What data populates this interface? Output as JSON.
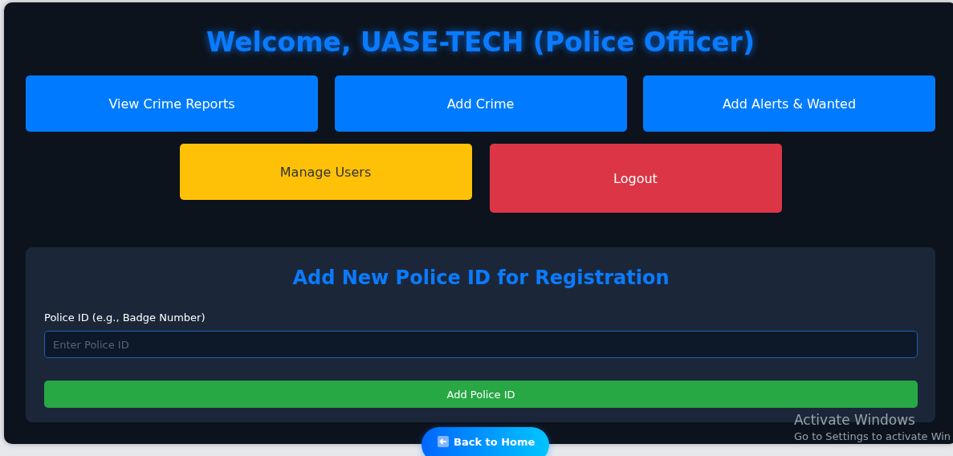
{
  "header": {
    "title": "Welcome, UASE-TECH (Police Officer)"
  },
  "actions": [
    {
      "label": "View Crime Reports",
      "kind": "primary"
    },
    {
      "label": "Add Crime",
      "kind": "primary"
    },
    {
      "label": "Add Alerts & Wanted",
      "kind": "primary"
    },
    {
      "label": "Manage Users",
      "kind": "warning"
    },
    {
      "label": "Logout",
      "kind": "danger"
    }
  ],
  "form": {
    "title": "Add New Police ID for Registration",
    "field_label": "Police ID (e.g., Badge Number)",
    "placeholder": "Enter Police ID",
    "submit": "Add Police ID"
  },
  "back_button": {
    "label": "Back to Home"
  },
  "os_notice": {
    "title": "Activate Windows",
    "text": "Go to Settings to activate Win"
  }
}
